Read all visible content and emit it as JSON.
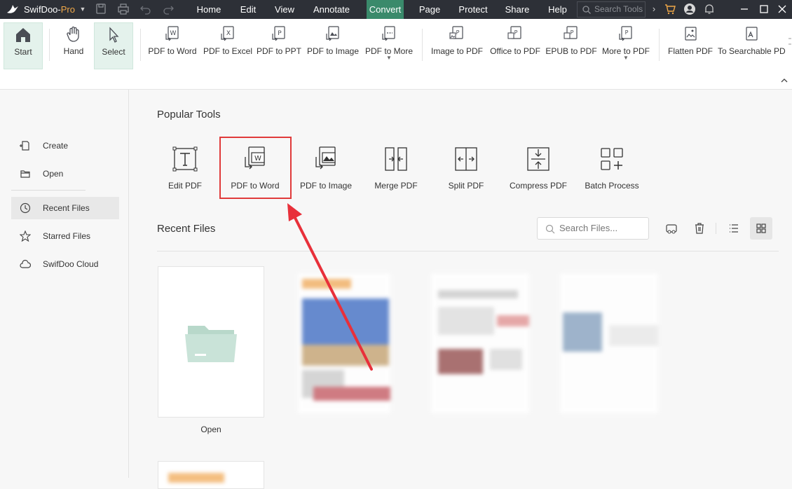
{
  "app": {
    "name": "SwifDoo-",
    "name_suffix": "Pro"
  },
  "menu": {
    "items": [
      "Home",
      "Edit",
      "View",
      "Annotate",
      "Convert",
      "Page",
      "Protect",
      "Share",
      "Help"
    ],
    "active": "Convert",
    "search_tools_placeholder": "Search Tools"
  },
  "ribbon": {
    "start": "Start",
    "hand": "Hand",
    "select": "Select",
    "pdf_to_word": "PDF to Word",
    "pdf_to_excel": "PDF to Excel",
    "pdf_to_ppt": "PDF to PPT",
    "pdf_to_image": "PDF to Image",
    "pdf_to_more": "PDF to More",
    "image_to_pdf": "Image to PDF",
    "office_to_pdf": "Office to PDF",
    "epub_to_pdf": "EPUB to PDF",
    "more_to_pdf": "More to PDF",
    "flatten_pdf": "Flatten PDF",
    "to_searchable_pdf": "To Searchable PD"
  },
  "sidebar": {
    "items": [
      {
        "label": "Create",
        "icon": "create-icon"
      },
      {
        "label": "Open",
        "icon": "folder-icon"
      },
      {
        "label": "Recent Files",
        "icon": "clock-icon"
      },
      {
        "label": "Starred Files",
        "icon": "star-icon"
      },
      {
        "label": "SwifDoo Cloud",
        "icon": "cloud-icon"
      }
    ],
    "active": "Recent Files"
  },
  "popular_tools": {
    "title": "Popular Tools",
    "items": [
      "Edit PDF",
      "PDF to Word",
      "PDF to Image",
      "Merge PDF",
      "Split PDF",
      "Compress PDF",
      "Batch Process"
    ]
  },
  "recent_files": {
    "title": "Recent Files",
    "search_placeholder": "Search Files...",
    "open_label": "Open"
  },
  "colors": {
    "titlebar_bg": "#2d3037",
    "accent": "#3a8a6b",
    "highlight": "#e03a3a",
    "folder": "#c4e0d4"
  }
}
